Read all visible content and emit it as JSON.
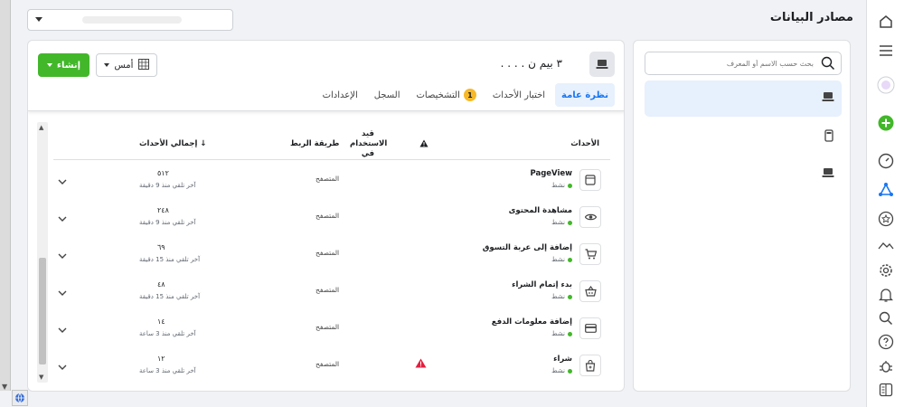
{
  "header": {
    "title": "مصادر البيانات"
  },
  "sources": {
    "search_placeholder": "بحث حسب الاسم أو المعرف"
  },
  "pixel": {
    "name": ". . . . ٣ بيم ن"
  },
  "toolbar": {
    "create_label": "إنشاء",
    "date_label": "أمس"
  },
  "tabs": [
    {
      "label": "نظرة عامة",
      "active": true
    },
    {
      "label": "اختبار الأحداث"
    },
    {
      "label": "التشخيصات",
      "badge": "1"
    },
    {
      "label": "السجل"
    },
    {
      "label": "الإعدادات"
    }
  ],
  "table": {
    "headers": {
      "events": "الأحداث",
      "usage": "قيد الاستخدام في",
      "method": "طريقة الربط",
      "total": "إجمالي الأحداث ↓"
    },
    "rows": [
      {
        "name": "PageView",
        "status": "نشط",
        "icon": "browser-window-icon",
        "method": "المتصفح",
        "total": "٥١٢",
        "received": "آخر تلقي منذ 9 دقيقة",
        "warning": false
      },
      {
        "name": "مشاهدة المحتوى",
        "status": "نشط",
        "icon": "eye-icon",
        "method": "المتصفح",
        "total": "٢٤٨",
        "received": "آخر تلقي منذ 9 دقيقة",
        "warning": false
      },
      {
        "name": "إضافة إلى عربة التسوق",
        "status": "نشط",
        "icon": "cart-icon",
        "method": "المتصفح",
        "total": "٦٩",
        "received": "آخر تلقي منذ 15 دقيقة",
        "warning": false
      },
      {
        "name": "بدء إتمام الشراء",
        "status": "نشط",
        "icon": "basket-icon",
        "method": "المتصفح",
        "total": "٤٨",
        "received": "آخر تلقي منذ 15 دقيقة",
        "warning": false
      },
      {
        "name": "إضافة معلومات الدفع",
        "status": "نشط",
        "icon": "credit-card-icon",
        "method": "المتصفح",
        "total": "١٤",
        "received": "آخر تلقي منذ 3 ساعة",
        "warning": false
      },
      {
        "name": "شراء",
        "status": "نشط",
        "icon": "purchase-bag-icon",
        "method": "المتصفح",
        "total": "١٢",
        "received": "آخر تلقي منذ 3 ساعة",
        "warning": true
      }
    ]
  },
  "colors": {
    "accent": "#1877f2",
    "create_button": "#42b72a",
    "warning": "#e41e3f",
    "badge": "#f7b928"
  }
}
